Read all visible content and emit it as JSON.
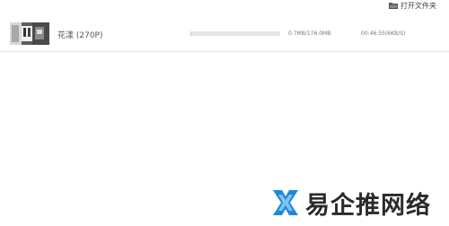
{
  "toolbar": {
    "open_folder_label": "打开文件夹",
    "open_folder_icon": "folder-icon"
  },
  "downloads": [
    {
      "name": "花漾 (270P)",
      "progress_fraction": 0.004,
      "size_text": "0.7MB/176.0MB",
      "time_text": "00:46:55(6KB/S)"
    }
  ],
  "watermark": {
    "text": "易企推网络"
  },
  "colors": {
    "progress_track": "#e6e6e6",
    "progress_fill": "#c8c8c8",
    "watermark_blue": "#1e88d6"
  }
}
